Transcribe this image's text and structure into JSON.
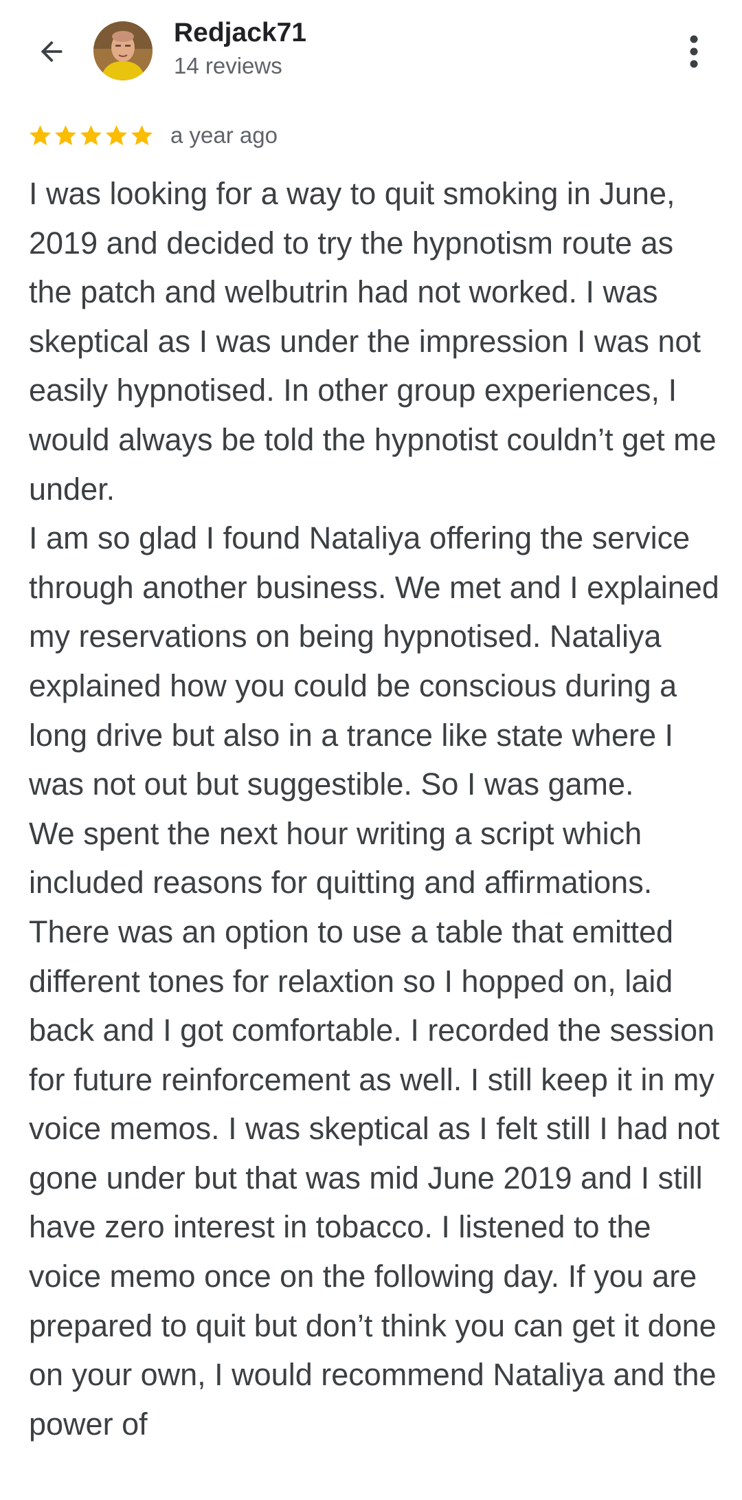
{
  "header": {
    "user_name": "Redjack71",
    "review_count": "14 reviews",
    "back_icon": "arrow-back-icon",
    "menu_icon": "more-vert-icon"
  },
  "review": {
    "rating": 5,
    "max_rating": 5,
    "star_color": "#fbbc04",
    "time_ago": "a year ago",
    "paragraphs": [
      "I was looking for a way to quit smoking in June, 2019 and decided to try the hypnotism route as the patch and welbutrin had not worked. I was skeptical as I was under the impression I was not easily hypnotised. In other group experiences, I would always be told the hypnotist couldn’t get me under.",
      "I am so glad I found Nataliya offering the service through another business. We met and I explained my reservations on being hypnotised. Nataliya explained how you could be conscious during a long drive but also in a trance like state where I was not out but suggestible. So I was game.",
      "We spent the next hour writing a script which included reasons for quitting and affirmations. There was an option to use a table that emitted different tones for relaxtion so I hopped on, laid back and I got comfortable. I recorded the session for future reinforcement as well. I still keep it in my voice memos. I was skeptical as I felt still I had not gone under but that was mid June 2019 and I still have zero interest in tobacco. I listened to the voice memo once on the following day. If you are prepared to quit but don’t think you can get it done on your own, I would recommend Nataliya and the power of"
    ]
  }
}
